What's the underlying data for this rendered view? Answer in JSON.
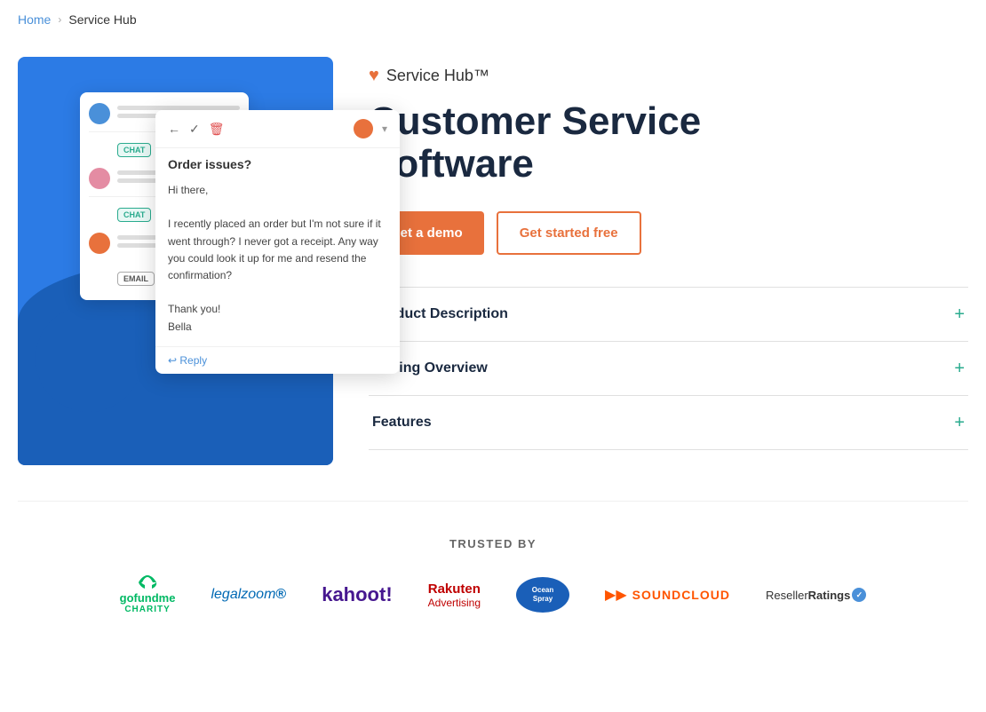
{
  "breadcrumb": {
    "home": "Home",
    "separator": "›",
    "current": "Service Hub"
  },
  "product": {
    "badge_icon": "♥",
    "badge_name": "Service Hub™",
    "title_line1": "Customer Service",
    "title_line2": "Software",
    "btn_demo": "Get a demo",
    "btn_free": "Get started free"
  },
  "accordion": {
    "items": [
      {
        "label": "Product Description",
        "icon": "+"
      },
      {
        "label": "Pricing Overview",
        "icon": "+"
      },
      {
        "label": "Features",
        "icon": "+"
      }
    ]
  },
  "trusted": {
    "label": "TRUSTED BY",
    "logos": [
      {
        "name": "GoFundMe Charity"
      },
      {
        "name": "LegalZoom"
      },
      {
        "name": "kahoot!"
      },
      {
        "name": "Rakuten Advertising"
      },
      {
        "name": "Ocean Spray"
      },
      {
        "name": "SoundCloud"
      },
      {
        "name": "ResellerRatings"
      }
    ]
  },
  "email_compose": {
    "subject": "Order issues?",
    "greeting": "Hi there,",
    "body": "I recently placed an order but I'm not sure if it went through? I never got a receipt. Any way you could look it up for me and resend the confirmation?",
    "closing": "Thank you!\nBella",
    "reply_label": "↩ Reply"
  }
}
